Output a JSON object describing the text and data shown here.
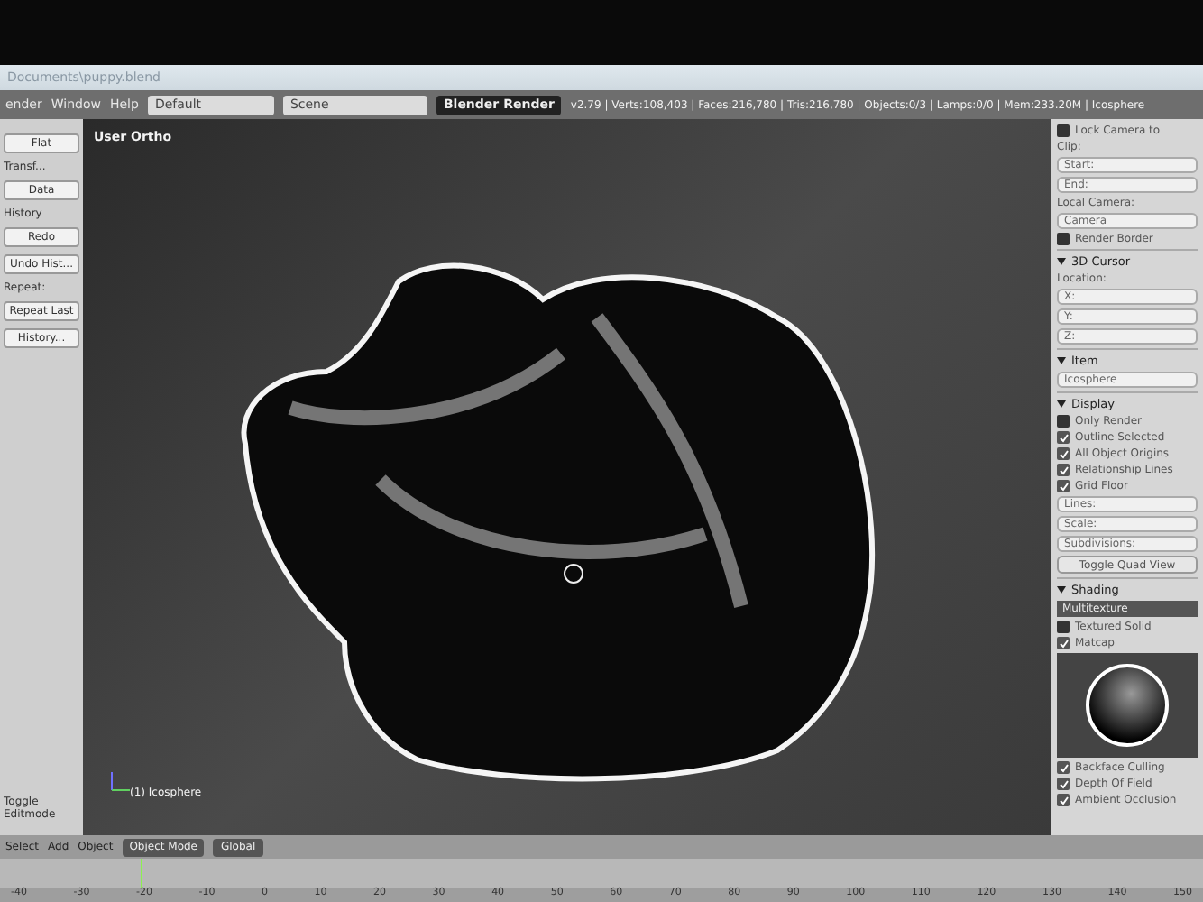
{
  "title_bar": {
    "title": "Documents\\puppy.blend"
  },
  "header": {
    "menus": [
      "ender",
      "Window",
      "Help"
    ],
    "layout": "Default",
    "scene": "Scene",
    "engine": "Blender Render",
    "stats": "v2.79 | Verts:108,403 | Faces:216,780 | Tris:216,780 | Objects:0/3 | Lamps:0/0 | Mem:233.20M | Icosphere"
  },
  "tool_shelf": [
    {
      "kind": "button",
      "text": "Flat"
    },
    {
      "kind": "label",
      "text": "Transf..."
    },
    {
      "kind": "button",
      "text": "Data"
    },
    {
      "kind": "label",
      "text": "History"
    },
    {
      "kind": "button",
      "text": "Redo"
    },
    {
      "kind": "button",
      "text": "Undo Hist..."
    },
    {
      "kind": "label",
      "text": "Repeat:"
    },
    {
      "kind": "button",
      "text": "Repeat Last"
    },
    {
      "kind": "button",
      "text": "History..."
    },
    {
      "kind": "spacer"
    },
    {
      "kind": "label",
      "text": "Toggle Editmode"
    }
  ],
  "viewport": {
    "view_name": "User Ortho",
    "object_label": "(1) Icosphere"
  },
  "properties": [
    {
      "kind": "checkbox",
      "text": "Lock Camera to",
      "checked": false
    },
    {
      "kind": "label",
      "text": "Clip:"
    },
    {
      "kind": "field",
      "text": "Start:"
    },
    {
      "kind": "field",
      "text": "End:"
    },
    {
      "kind": "label",
      "text": "Local Camera:"
    },
    {
      "kind": "field",
      "text": "Camera"
    },
    {
      "kind": "checkbox",
      "text": "Render Border",
      "checked": false
    },
    {
      "kind": "header",
      "text": "3D Cursor"
    },
    {
      "kind": "label",
      "text": "Location:"
    },
    {
      "kind": "field",
      "text": "X:"
    },
    {
      "kind": "field",
      "text": "Y:"
    },
    {
      "kind": "field",
      "text": "Z:"
    },
    {
      "kind": "header",
      "text": "Item"
    },
    {
      "kind": "field",
      "text": "Icosphere"
    },
    {
      "kind": "header",
      "text": "Display"
    },
    {
      "kind": "checkbox",
      "text": "Only Render",
      "checked": false
    },
    {
      "kind": "checkbox",
      "text": "Outline Selected",
      "checked": true
    },
    {
      "kind": "checkbox",
      "text": "All Object Origins",
      "checked": true
    },
    {
      "kind": "checkbox",
      "text": "Relationship Lines",
      "checked": true
    },
    {
      "kind": "checkbox",
      "text": "Grid Floor",
      "checked": true
    },
    {
      "kind": "field",
      "text": "Lines:"
    },
    {
      "kind": "field",
      "text": "Scale:"
    },
    {
      "kind": "field",
      "text": "Subdivisions:"
    },
    {
      "kind": "button",
      "text": "Toggle Quad View"
    },
    {
      "kind": "header",
      "text": "Shading"
    },
    {
      "kind": "dropdown",
      "text": "Multitexture"
    },
    {
      "kind": "checkbox",
      "text": "Textured Solid",
      "checked": false
    },
    {
      "kind": "checkbox",
      "text": "Matcap",
      "checked": true
    },
    {
      "kind": "preview"
    },
    {
      "kind": "checkbox",
      "text": "Backface Culling",
      "checked": true
    },
    {
      "kind": "checkbox",
      "text": "Depth Of Field",
      "checked": true
    },
    {
      "kind": "checkbox",
      "text": "Ambient Occlusion",
      "checked": true
    }
  ],
  "view_header": {
    "menus": [
      "Select",
      "Add",
      "Object"
    ],
    "mode": "Object Mode",
    "orientation": "Global"
  },
  "timeline": {
    "ticks": [
      "-40",
      "-30",
      "-20",
      "-10",
      "0",
      "10",
      "20",
      "30",
      "40",
      "50",
      "60",
      "70",
      "80",
      "90",
      "100",
      "110",
      "120",
      "130",
      "140",
      "150"
    ]
  }
}
